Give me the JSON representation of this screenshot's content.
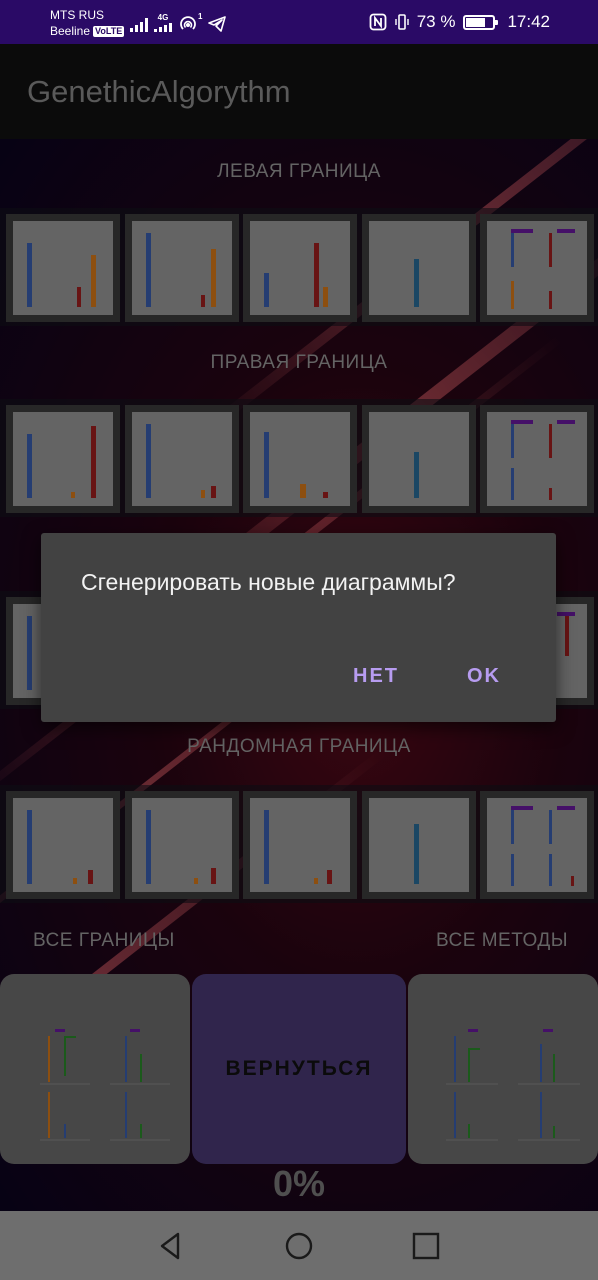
{
  "status_bar": {
    "carrier1": "MTS RUS",
    "carrier2": "Beeline",
    "volte": "VoLTE",
    "net_type": "4G",
    "hotspot_count": "1",
    "battery_percent": "73 %",
    "battery_level": 0.73,
    "time": "17:42"
  },
  "app_bar": {
    "title": "GenethicAlgorythm"
  },
  "sections": {
    "left": "ЛЕВАЯ ГРАНИЦА",
    "right": "ПРАВАЯ ГРАНИЦА",
    "random": "РАНДОМНАЯ ГРАНИЦА"
  },
  "bottom": {
    "all_bounds": "ВСЕ ГРАНИЦЫ",
    "all_methods": "ВСЕ МЕТОДЫ",
    "back_button": "ВЕРНУТЬСЯ",
    "progress": "0%"
  },
  "dialog": {
    "message": "Сгенерировать новые диаграммы?",
    "negative": "НЕТ",
    "positive": "OK"
  },
  "colors": {
    "status_bar": "#2a0a66",
    "accent": "#b79cf0",
    "back_button": "#4b3a75",
    "series_blue": "#3a5fb0",
    "series_orange": "#d97a1a",
    "series_red": "#a02020",
    "series_teal": "#2a6d9a",
    "series_purple": "#6a1aa0",
    "series_green": "#2a8a2a"
  },
  "icons": {
    "nav_back": "triangle-back-icon",
    "nav_home": "circle-home-icon",
    "nav_recents": "square-recents-icon"
  }
}
